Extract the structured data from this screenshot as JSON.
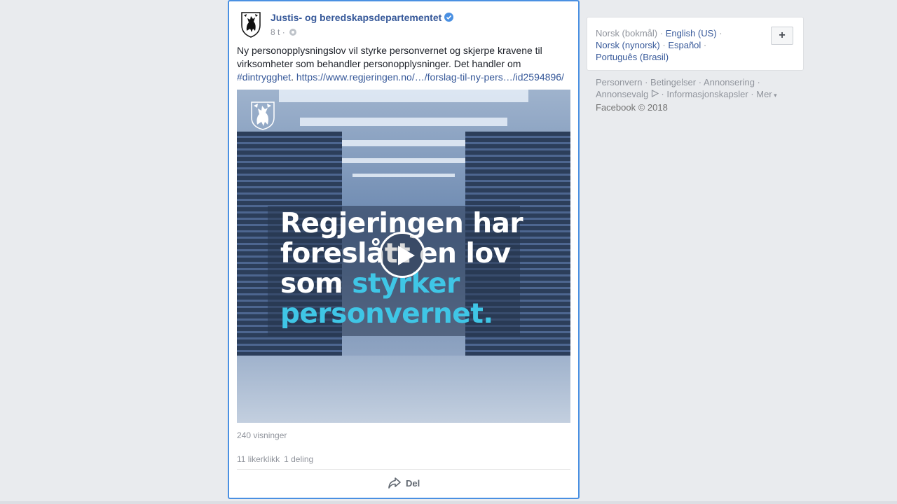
{
  "post": {
    "page_name": "Justis- og beredskapsdepartementet",
    "timestamp": "8 t",
    "separator": "·",
    "text": "Ny personopplysningslov vil styrke personvernet og skjerpe kravene til virksomheter som behandler personopplysninger. Det handler om",
    "hashtag": "#dintrygghet",
    "link_text": "https://www.regjeringen.no/…/forslag-til-ny-pers…/id2594896/",
    "video": {
      "line1": "Regjeringen har",
      "line2": "foreslått en lov",
      "line3_white": "som",
      "line3_accent": "styrker",
      "line4_accent": "personvernet."
    },
    "views": "240 visninger",
    "likes": "11 likerklikk",
    "shares": "1 deling",
    "share_label": "Del"
  },
  "sidebar": {
    "languages": {
      "current": "Norsk (bokmål)",
      "options": [
        "English (US)",
        "Norsk (nynorsk)",
        "Español",
        "Português (Brasil)"
      ],
      "add_label": "+"
    },
    "footer": {
      "links": [
        "Personvern",
        "Betingelser",
        "Annonsering",
        "Annonsevalg",
        "Informasjonskapsler",
        "Mer"
      ],
      "copyright": "Facebook © 2018"
    }
  },
  "colors": {
    "link": "#365899",
    "accent_text": "#3fc6e6",
    "focus_border": "#4a90e2",
    "background": "#e9ebee"
  }
}
